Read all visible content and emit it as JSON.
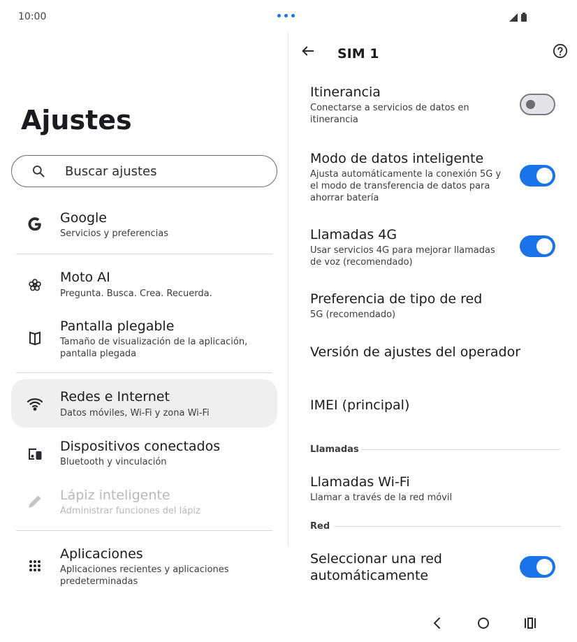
{
  "status": {
    "time": "10:00"
  },
  "left": {
    "title": "Ajustes",
    "search": {
      "placeholder": "Buscar ajustes"
    },
    "items": [
      {
        "title": "Google",
        "subtitle": "Servicios y preferencias",
        "icon": "google-icon"
      },
      {
        "title": "Moto AI",
        "subtitle": "Pregunta. Busca. Crea. Recuerda.",
        "icon": "moto-ai-icon"
      },
      {
        "title": "Pantalla plegable",
        "subtitle": "Tamaño de visualización de la aplicación, pantalla plegada",
        "icon": "foldable-display-icon"
      },
      {
        "title": "Redes e Internet",
        "subtitle": "Datos móviles, Wi-Fi y zona Wi-Fi",
        "icon": "wifi-icon"
      },
      {
        "title": "Dispositivos conectados",
        "subtitle": "Bluetooth y vinculación",
        "icon": "connected-devices-icon"
      },
      {
        "title": "Lápiz inteligente",
        "subtitle": "Administrar funciones del lápiz",
        "icon": "stylus-icon"
      },
      {
        "title": "Aplicaciones",
        "subtitle": "Aplicaciones recientes y aplicaciones predeterminadas",
        "icon": "apps-grid-icon"
      }
    ]
  },
  "right": {
    "title": "SIM 1",
    "settings": [
      {
        "title": "Itinerancia",
        "subtitle": "Conectarse a servicios de datos en itinerancia",
        "toggle": false
      },
      {
        "title": "Modo de datos inteligente",
        "subtitle": "Ajusta automáticamente la conexión 5G y el modo de transferencia de datos para ahorrar batería",
        "toggle": true
      },
      {
        "title": "Llamadas 4G",
        "subtitle": "Usar servicios 4G para mejorar llamadas de voz (recomendado)",
        "toggle": true
      },
      {
        "title": "Preferencia de tipo de red",
        "subtitle": "5G (recomendado)"
      },
      {
        "title": "Versión de ajustes del operador"
      },
      {
        "title": "IMEI (principal)"
      },
      {
        "title": "Llamadas Wi-Fi",
        "subtitle": "Llamar a través de la red móvil"
      },
      {
        "title": "Seleccionar una red automáticamente",
        "toggle": true
      }
    ],
    "sections": {
      "calls": "Llamadas",
      "network": "Red"
    }
  },
  "colors": {
    "accent": "#1a73e8",
    "active_item_bg": "#efefef",
    "disabled_text": "#b9b9bd"
  }
}
